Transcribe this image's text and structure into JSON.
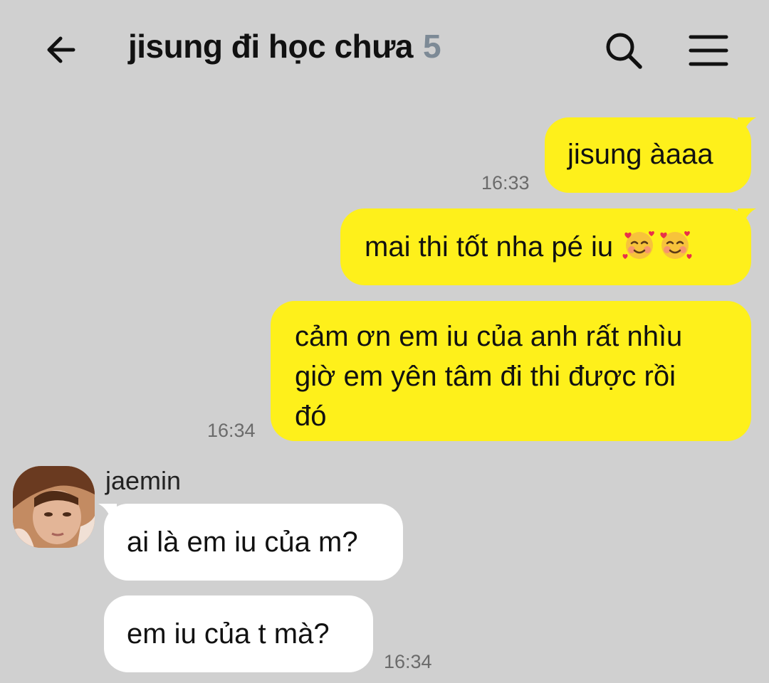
{
  "header": {
    "title": "jisung đi học chưa",
    "member_count": "5",
    "back_icon": "arrow-left-icon",
    "search_icon": "search-icon",
    "menu_icon": "hamburger-menu-icon"
  },
  "messages": {
    "m1": {
      "text": "jisung àaaa",
      "time": "16:33"
    },
    "m2": {
      "text": "mai thi tốt nha pé iu",
      "emoji": "smiling-face-with-hearts x2"
    },
    "m3": {
      "lines": [
        "cảm ơn em iu của anh rất nhìu",
        "giờ em yên tâm đi thi được rồi",
        "đó"
      ],
      "time": "16:34"
    },
    "sender": {
      "name": "jaemin"
    },
    "m4": {
      "text": "ai là em iu của m?"
    },
    "m5": {
      "text": "em iu của t mà?",
      "time": "16:34"
    }
  },
  "colors": {
    "background": "#d0d0d0",
    "outgoing_bubble": "#fef01b",
    "incoming_bubble": "#ffffff",
    "count": "#7d8a96"
  }
}
